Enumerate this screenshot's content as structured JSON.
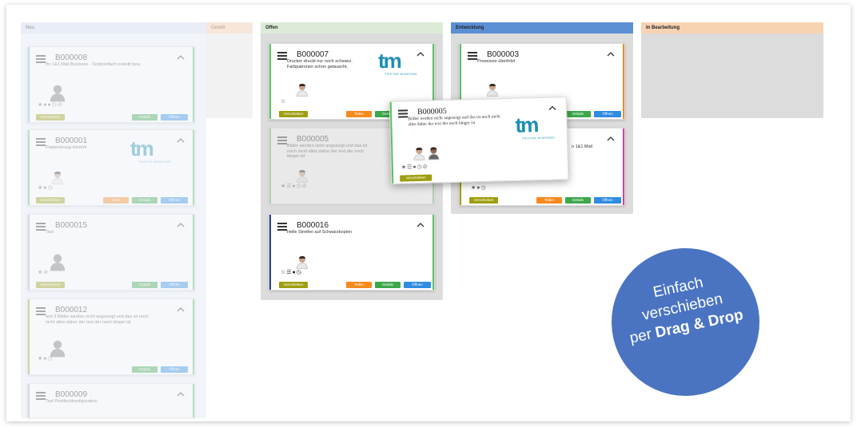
{
  "columns": [
    {
      "key": "neu",
      "title": "Neu",
      "bg": "#f1f4f9",
      "head": "#e8edf6"
    },
    {
      "key": "geteilt",
      "title": "Geteilt",
      "bg": "#f2f2f2",
      "head": "#f7e6da"
    },
    {
      "key": "offen",
      "title": "Offen",
      "bg": "#dcdcdc",
      "head": "#dcebd7"
    },
    {
      "key": "entwicklung",
      "title": "Entwicklung",
      "bg": "#dcdcdc",
      "head": "#5b8fd4"
    },
    {
      "key": "inbearbeitung",
      "title": "In Bearbeitung",
      "bg": "#dcdcdc",
      "head": "#f8d3b2"
    }
  ],
  "buttons": {
    "move": "Verschieben",
    "take": "Teilen",
    "details": "Details",
    "open": "Öffnen"
  },
  "cards": {
    "b8": {
      "id": "B000008",
      "desc": "Ihr 1&1 Mail Business - Testpostfach erstellt bzw."
    },
    "b1": {
      "id": "B000001",
      "desc": "Papiereinzug klemmt"
    },
    "b15": {
      "id": "B000015",
      "desc": "Test"
    },
    "b12": {
      "id": "B000012",
      "desc": "test 3 Bilder werden nicht angezeigt und das ist noch nicht alles daher der text der noch länger ist"
    },
    "b9": {
      "id": "B000009",
      "desc": "Test Postfachkonfiguration"
    },
    "b7": {
      "id": "B000007",
      "desc": "Drucker druckt nur noch schwarz. Farbpatronen schon getauscht."
    },
    "b5ghost": {
      "id": "B000005",
      "desc": "Bilder werden nicht angezeigt und das ist noch nicht alles daher der text der noch länger ist"
    },
    "b16": {
      "id": "B000016",
      "desc": "Helle Streifen auf Schwarzkopien"
    },
    "b3": {
      "id": "B000003",
      "desc": "Prozessor überhitzt"
    },
    "b_entw2": {
      "id": "",
      "desc": "n 1&1 Mail"
    },
    "b5drag": {
      "id": "B000005",
      "desc": "Bilder werden nicht angezeigt und das ist noch nicht alles daher der text der noch länger ist"
    }
  },
  "logo": {
    "text": "tm",
    "sub": "TRISTAR WINDOWS"
  },
  "promo": {
    "line1": "Einfach",
    "line2": "verschieben",
    "line3_pre": "per ",
    "line3_bold": "Drag & Drop"
  }
}
